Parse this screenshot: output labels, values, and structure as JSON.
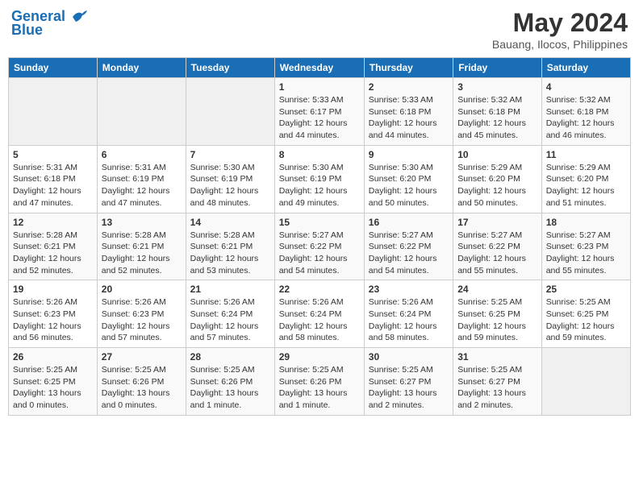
{
  "header": {
    "logo_line1": "General",
    "logo_line2": "Blue",
    "month_title": "May 2024",
    "subtitle": "Bauang, Ilocos, Philippines"
  },
  "weekdays": [
    "Sunday",
    "Monday",
    "Tuesday",
    "Wednesday",
    "Thursday",
    "Friday",
    "Saturday"
  ],
  "weeks": [
    [
      {
        "day": "",
        "info": ""
      },
      {
        "day": "",
        "info": ""
      },
      {
        "day": "",
        "info": ""
      },
      {
        "day": "1",
        "info": "Sunrise: 5:33 AM\nSunset: 6:17 PM\nDaylight: 12 hours\nand 44 minutes."
      },
      {
        "day": "2",
        "info": "Sunrise: 5:33 AM\nSunset: 6:18 PM\nDaylight: 12 hours\nand 44 minutes."
      },
      {
        "day": "3",
        "info": "Sunrise: 5:32 AM\nSunset: 6:18 PM\nDaylight: 12 hours\nand 45 minutes."
      },
      {
        "day": "4",
        "info": "Sunrise: 5:32 AM\nSunset: 6:18 PM\nDaylight: 12 hours\nand 46 minutes."
      }
    ],
    [
      {
        "day": "5",
        "info": "Sunrise: 5:31 AM\nSunset: 6:18 PM\nDaylight: 12 hours\nand 47 minutes."
      },
      {
        "day": "6",
        "info": "Sunrise: 5:31 AM\nSunset: 6:19 PM\nDaylight: 12 hours\nand 47 minutes."
      },
      {
        "day": "7",
        "info": "Sunrise: 5:30 AM\nSunset: 6:19 PM\nDaylight: 12 hours\nand 48 minutes."
      },
      {
        "day": "8",
        "info": "Sunrise: 5:30 AM\nSunset: 6:19 PM\nDaylight: 12 hours\nand 49 minutes."
      },
      {
        "day": "9",
        "info": "Sunrise: 5:30 AM\nSunset: 6:20 PM\nDaylight: 12 hours\nand 50 minutes."
      },
      {
        "day": "10",
        "info": "Sunrise: 5:29 AM\nSunset: 6:20 PM\nDaylight: 12 hours\nand 50 minutes."
      },
      {
        "day": "11",
        "info": "Sunrise: 5:29 AM\nSunset: 6:20 PM\nDaylight: 12 hours\nand 51 minutes."
      }
    ],
    [
      {
        "day": "12",
        "info": "Sunrise: 5:28 AM\nSunset: 6:21 PM\nDaylight: 12 hours\nand 52 minutes."
      },
      {
        "day": "13",
        "info": "Sunrise: 5:28 AM\nSunset: 6:21 PM\nDaylight: 12 hours\nand 52 minutes."
      },
      {
        "day": "14",
        "info": "Sunrise: 5:28 AM\nSunset: 6:21 PM\nDaylight: 12 hours\nand 53 minutes."
      },
      {
        "day": "15",
        "info": "Sunrise: 5:27 AM\nSunset: 6:22 PM\nDaylight: 12 hours\nand 54 minutes."
      },
      {
        "day": "16",
        "info": "Sunrise: 5:27 AM\nSunset: 6:22 PM\nDaylight: 12 hours\nand 54 minutes."
      },
      {
        "day": "17",
        "info": "Sunrise: 5:27 AM\nSunset: 6:22 PM\nDaylight: 12 hours\nand 55 minutes."
      },
      {
        "day": "18",
        "info": "Sunrise: 5:27 AM\nSunset: 6:23 PM\nDaylight: 12 hours\nand 55 minutes."
      }
    ],
    [
      {
        "day": "19",
        "info": "Sunrise: 5:26 AM\nSunset: 6:23 PM\nDaylight: 12 hours\nand 56 minutes."
      },
      {
        "day": "20",
        "info": "Sunrise: 5:26 AM\nSunset: 6:23 PM\nDaylight: 12 hours\nand 57 minutes."
      },
      {
        "day": "21",
        "info": "Sunrise: 5:26 AM\nSunset: 6:24 PM\nDaylight: 12 hours\nand 57 minutes."
      },
      {
        "day": "22",
        "info": "Sunrise: 5:26 AM\nSunset: 6:24 PM\nDaylight: 12 hours\nand 58 minutes."
      },
      {
        "day": "23",
        "info": "Sunrise: 5:26 AM\nSunset: 6:24 PM\nDaylight: 12 hours\nand 58 minutes."
      },
      {
        "day": "24",
        "info": "Sunrise: 5:25 AM\nSunset: 6:25 PM\nDaylight: 12 hours\nand 59 minutes."
      },
      {
        "day": "25",
        "info": "Sunrise: 5:25 AM\nSunset: 6:25 PM\nDaylight: 12 hours\nand 59 minutes."
      }
    ],
    [
      {
        "day": "26",
        "info": "Sunrise: 5:25 AM\nSunset: 6:25 PM\nDaylight: 13 hours\nand 0 minutes."
      },
      {
        "day": "27",
        "info": "Sunrise: 5:25 AM\nSunset: 6:26 PM\nDaylight: 13 hours\nand 0 minutes."
      },
      {
        "day": "28",
        "info": "Sunrise: 5:25 AM\nSunset: 6:26 PM\nDaylight: 13 hours\nand 1 minute."
      },
      {
        "day": "29",
        "info": "Sunrise: 5:25 AM\nSunset: 6:26 PM\nDaylight: 13 hours\nand 1 minute."
      },
      {
        "day": "30",
        "info": "Sunrise: 5:25 AM\nSunset: 6:27 PM\nDaylight: 13 hours\nand 2 minutes."
      },
      {
        "day": "31",
        "info": "Sunrise: 5:25 AM\nSunset: 6:27 PM\nDaylight: 13 hours\nand 2 minutes."
      },
      {
        "day": "",
        "info": ""
      }
    ]
  ]
}
